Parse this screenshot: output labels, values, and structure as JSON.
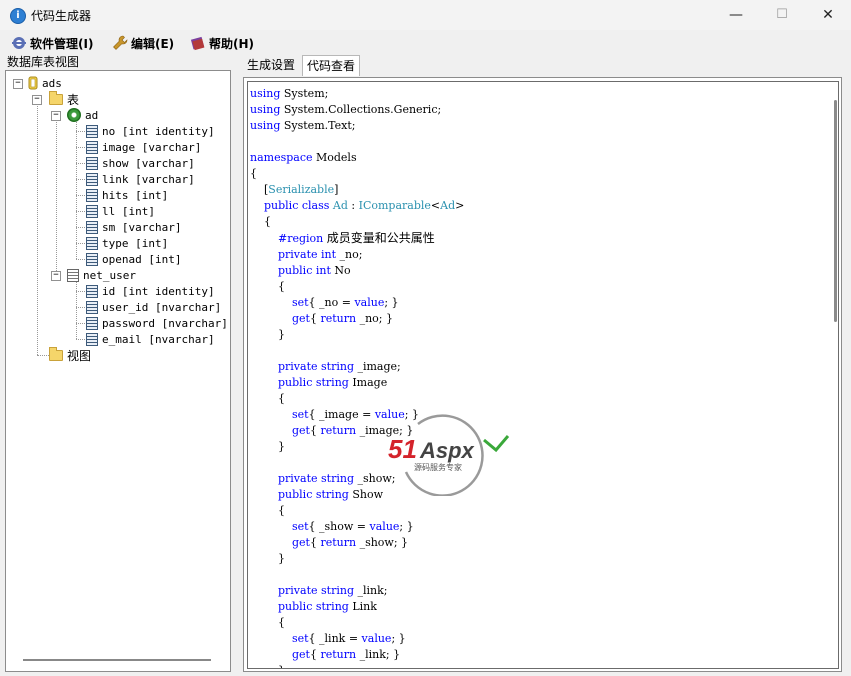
{
  "window": {
    "title": "代码生成器",
    "minimize": "—",
    "maximize": "☐",
    "close": "✕"
  },
  "menu": [
    {
      "label": "软件管理(I)",
      "icon": "settings-icon"
    },
    {
      "label": "编辑(E)",
      "icon": "wrench-icon"
    },
    {
      "label": "帮助(H)",
      "icon": "book-icon"
    }
  ],
  "left_panel": {
    "title": "数据库表视图"
  },
  "tree": {
    "db": {
      "label": "ads",
      "expander": "−"
    },
    "tables_folder": {
      "label": "表",
      "expander": "−"
    },
    "table_ad": {
      "label": "ad",
      "expander": "−",
      "fields": [
        "no  [int identity]",
        "image  [varchar]",
        "show  [varchar]",
        "link  [varchar]",
        "hits  [int]",
        "ll  [int]",
        "sm  [varchar]",
        "type  [int]",
        "openad  [int]"
      ]
    },
    "table_net_user": {
      "label": "net_user",
      "expander": "−",
      "fields": [
        "id  [int identity]",
        "user_id  [nvarchar]",
        "password  [nvarchar]",
        "e_mail  [nvarchar]"
      ]
    },
    "views_folder": {
      "label": "视图"
    }
  },
  "tabs": [
    {
      "label": "生成设置",
      "active": false
    },
    {
      "label": "代码查看",
      "active": true
    }
  ],
  "code": [
    "using System;",
    "using System.Collections.Generic;",
    "using System.Text;",
    "",
    "namespace Models",
    "{",
    "    [Serializable]",
    "    public class Ad : IComparable<Ad>",
    "    {",
    "        #region 成员变量和公共属性",
    "        private int _no;",
    "        public int No",
    "        {",
    "            set{ _no = value; }",
    "            get{ return _no; }",
    "        }",
    "",
    "        private string _image;",
    "        public string Image",
    "        {",
    "            set{ _image = value; }",
    "            get{ return _image; }",
    "        }",
    "",
    "        private string _show;",
    "        public string Show",
    "        {",
    "            set{ _show = value; }",
    "            get{ return _show; }",
    "        }",
    "",
    "        private string _link;",
    "        public string Link",
    "        {",
    "            set{ _link = value; }",
    "            get{ return _link; }",
    "        }"
  ],
  "watermark": {
    "brand_num": "51",
    "brand_text": "Aspx",
    "tagline": "源码服务专家"
  },
  "colors": {
    "keyword": "#0000ff",
    "type": "#2b91af",
    "watermark_red": "#d4232b",
    "watermark_green": "#3aa83a"
  }
}
